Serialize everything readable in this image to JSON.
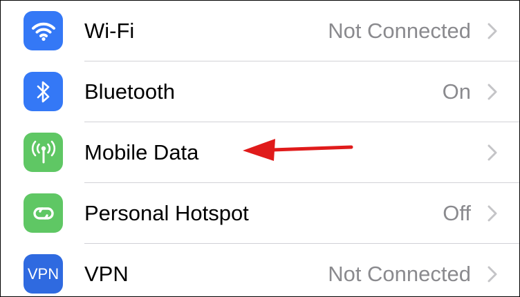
{
  "settings": {
    "rows": [
      {
        "label": "Wi-Fi",
        "value": "Not Connected",
        "icon": "wifi-icon",
        "icon_color": "#3478f6"
      },
      {
        "label": "Bluetooth",
        "value": "On",
        "icon": "bluetooth-icon",
        "icon_color": "#3478f6"
      },
      {
        "label": "Mobile Data",
        "value": "",
        "icon": "antenna-icon",
        "icon_color": "#5fc764"
      },
      {
        "label": "Personal Hotspot",
        "value": "Off",
        "icon": "hotspot-link-icon",
        "icon_color": "#5fc764"
      },
      {
        "label": "VPN",
        "value": "Not Connected",
        "icon": "vpn-icon",
        "icon_color": "#2f6ae0",
        "icon_text": "VPN"
      }
    ]
  },
  "annotation": {
    "arrow_color": "#e01b1b",
    "arrow_target": "Mobile Data"
  },
  "colors": {
    "label": "#000000",
    "value": "#8a8a8e",
    "chevron": "#c4c4c7",
    "separator": "#d1d1d6"
  }
}
